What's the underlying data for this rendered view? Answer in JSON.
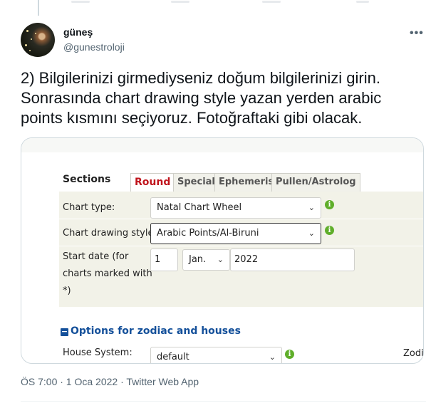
{
  "tweet": {
    "author_name": "güneş",
    "author_handle": "@gunestroloji",
    "more_label": "•••",
    "text_lines": [
      "2) Bilgilerinizi girmediyseniz doğum bilgilerinizi girin.",
      "Sonrasında chart drawing style yazan yerden arabic",
      "points kısmını seçiyoruz. Fotoğraftaki gibi olacak."
    ],
    "meta": "ÖS 7:00 · 1 Oca 2022 · Twitter Web App"
  },
  "screenshot": {
    "sections_label": "Sections",
    "tabs": [
      {
        "label": "Round",
        "active": true
      },
      {
        "label": "Special",
        "active": false
      },
      {
        "label": "Ephemeris",
        "active": false
      },
      {
        "label": "Pullen/Astrolog",
        "active": false
      }
    ],
    "fields": {
      "chart_type_label": "Chart type:",
      "chart_type_value": "Natal Chart Wheel",
      "drawing_style_label": "Chart drawing style:",
      "drawing_style_value": "Arabic Points/Al-Biruni",
      "start_date_label_lines": [
        "Start date (for",
        "charts marked with",
        "*)"
      ],
      "day_value": "1",
      "month_value": "Jan.",
      "year_value": "2022"
    },
    "options_heading": "Options for zodiac and houses",
    "house_system_label": "House System:",
    "house_system_value": "default",
    "cut_label": "Zodi",
    "caret": "⌄",
    "info_glyph": "i"
  },
  "colors": {
    "link_blue": "#14509a",
    "active_tab_red": "#c0141c",
    "info_green": "#5fae2a",
    "panel_bg": "#f2f2e8"
  }
}
